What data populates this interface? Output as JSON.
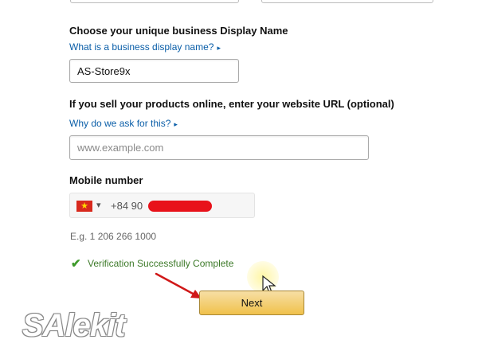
{
  "display_name": {
    "label": "Choose your unique business Display Name",
    "help_link": "What is a business display name?",
    "value": "AS-Store9x"
  },
  "website": {
    "label": "If you sell your products online, enter your website URL (optional)",
    "help_link": "Why do we ask for this?",
    "placeholder": "www.example.com"
  },
  "mobile": {
    "label": "Mobile number",
    "country_flag": "vietnam-flag",
    "prefix": "+84 90",
    "example_hint": "E.g. 1 206 266 1000"
  },
  "verification": {
    "message": "Verification Successfully Complete",
    "status_color": "#3d9a2a"
  },
  "next_button": {
    "label": "Next",
    "color": "#f0c14b"
  },
  "watermark": {
    "text": "SAlekit"
  },
  "icons": {
    "help_caret": "▸",
    "dropdown_caret": "▾",
    "check": "✔",
    "flag_star": "★"
  }
}
